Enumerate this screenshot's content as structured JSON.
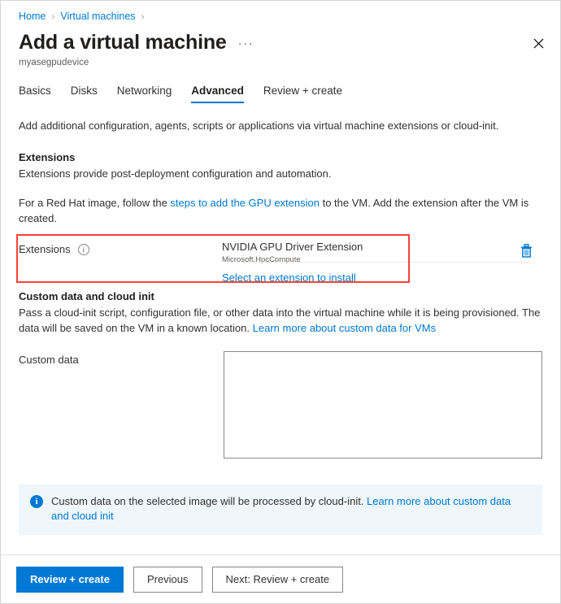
{
  "breadcrumb": {
    "items": [
      {
        "label": "Home"
      },
      {
        "label": "Virtual machines"
      }
    ],
    "separator": "›"
  },
  "header": {
    "title": "Add a virtual machine",
    "subtitle": "myasegpudevice",
    "more_label": "···",
    "close_label": "✕"
  },
  "tabs": [
    {
      "label": "Basics",
      "active": false
    },
    {
      "label": "Disks",
      "active": false
    },
    {
      "label": "Networking",
      "active": false
    },
    {
      "label": "Advanced",
      "active": true
    },
    {
      "label": "Review + create",
      "active": false
    }
  ],
  "main": {
    "intro": "Add additional configuration, agents, scripts or applications via virtual machine extensions or cloud-init.",
    "extensions_section": {
      "heading": "Extensions",
      "description": "Extensions provide post-deployment configuration and automation.",
      "note_prefix": "For a Red Hat image, follow the ",
      "note_link": "steps to add the GPU extension",
      "note_suffix": " to the VM. Add the extension after the VM is created.",
      "field_label": "Extensions",
      "info_glyph": "i",
      "selected_extension_name": "NVIDIA GPU Driver Extension",
      "selected_extension_publisher": "Microsoft.HpcCompute",
      "select_link": "Select an extension to install",
      "delete_tooltip": "Delete extension"
    },
    "custom_data_section": {
      "heading": "Custom data and cloud init",
      "description_line1": "Pass a cloud-init script, configuration file, or other data into the virtual machine while it is being provisioned.",
      "description_line2": "The data will be saved on the VM in a known location. ",
      "description_link": "Learn more about custom data for VMs",
      "field_label": "Custom data",
      "textarea_value": "",
      "textarea_placeholder": ""
    },
    "banner": {
      "icon_glyph": "i",
      "text_prefix": "Custom data on the selected image will be processed by cloud-init. ",
      "link": "Learn more about custom data and cloud init"
    }
  },
  "footer": {
    "primary_button": "Review + create",
    "previous_button": "Previous",
    "next_button": "Next: Review + create"
  },
  "colors": {
    "accent": "#0078d4",
    "highlight": "#f9423a",
    "banner_bg": "#eff6fc",
    "text": "#323130"
  }
}
